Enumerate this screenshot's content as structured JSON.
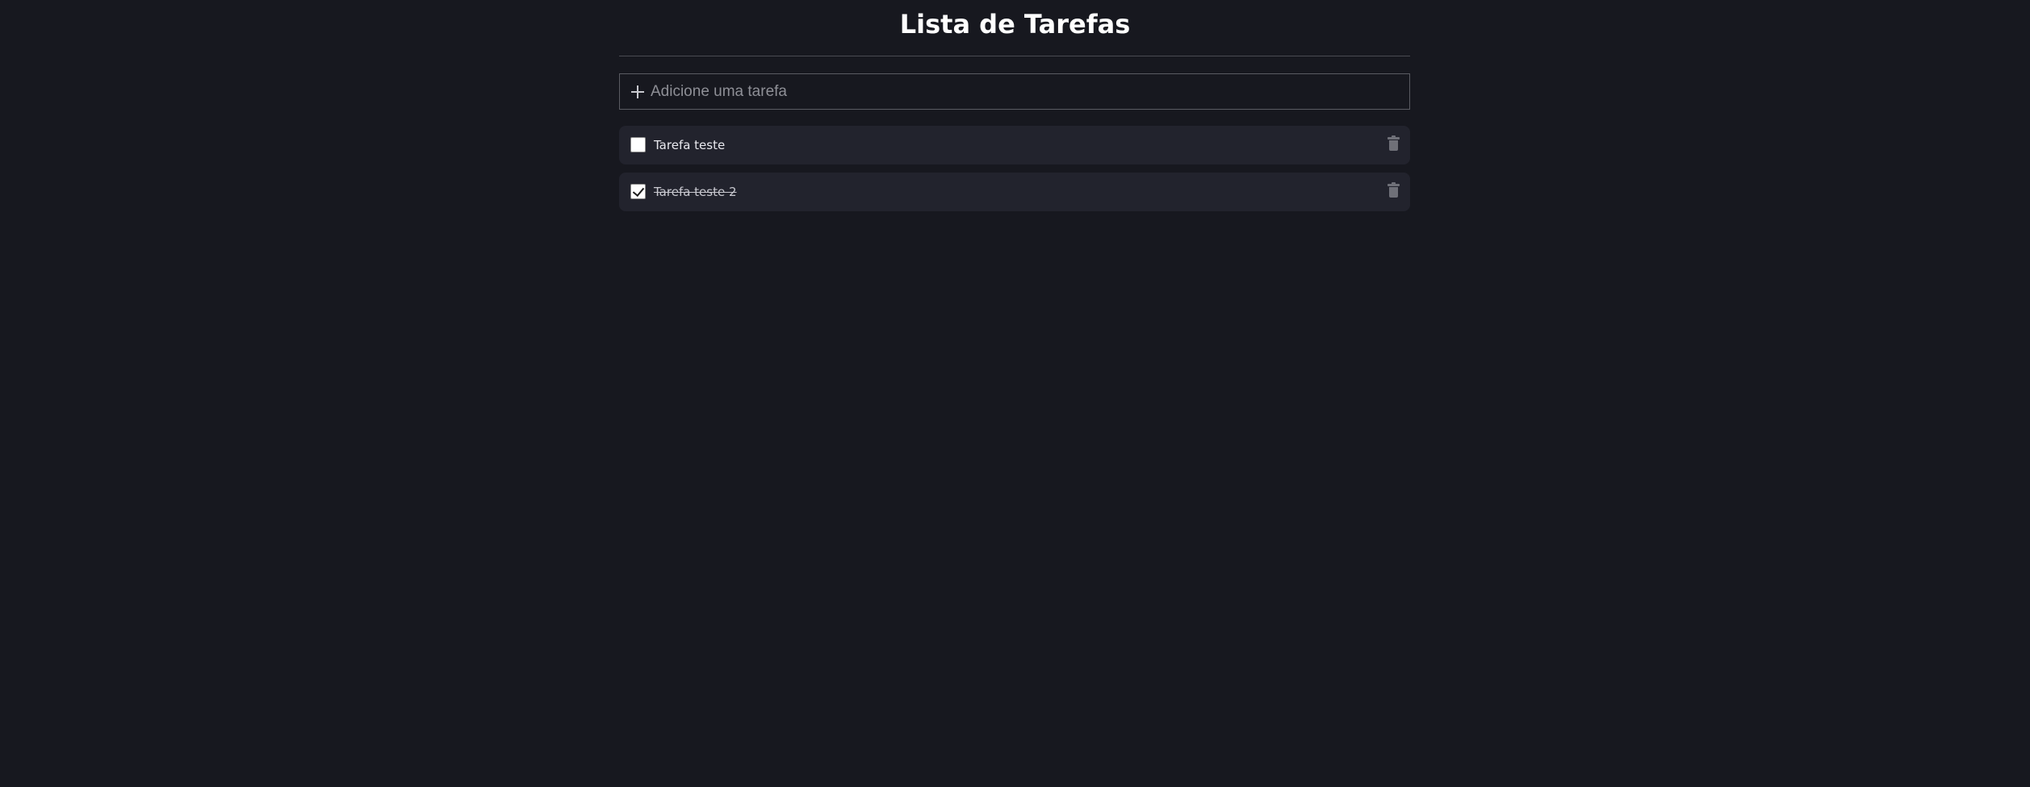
{
  "header": {
    "title": "Lista de Tarefas"
  },
  "add_task": {
    "placeholder": "Adicione uma tarefa",
    "value": ""
  },
  "tasks": [
    {
      "label": "Tarefa teste",
      "completed": false,
      "delete_icon": "trash-icon"
    },
    {
      "label": "Tarefa teste 2",
      "completed": true,
      "delete_icon": "trash-icon"
    }
  ],
  "colors": {
    "background": "#17181f",
    "task_background": "#22232d",
    "text": "#ffffff",
    "muted_icon": "#6f7078"
  },
  "icons": {
    "add": "plus-icon",
    "delete": "trash-icon",
    "checked": "checkbox-checked",
    "unchecked": "checkbox-unchecked"
  }
}
